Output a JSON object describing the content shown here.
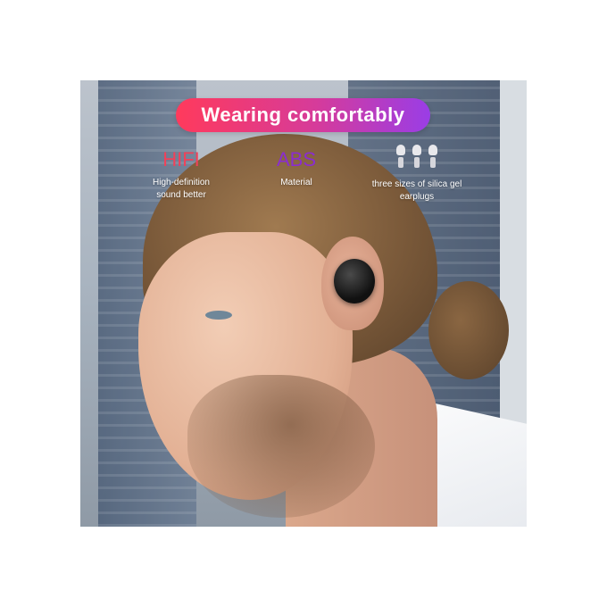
{
  "banner": {
    "title": "Wearing comfortably"
  },
  "features": [
    {
      "title": "HIFI",
      "description": "High-definition sound better",
      "color": "#f14159"
    },
    {
      "title": "ABS",
      "description": "Material",
      "color": "#8a2dcf"
    },
    {
      "icon": "earplug-tips-icon",
      "description": "three sizes of silica gel earplugs"
    }
  ],
  "colors": {
    "banner_start": "#ff3a5c",
    "banner_end": "#9a3de6"
  }
}
